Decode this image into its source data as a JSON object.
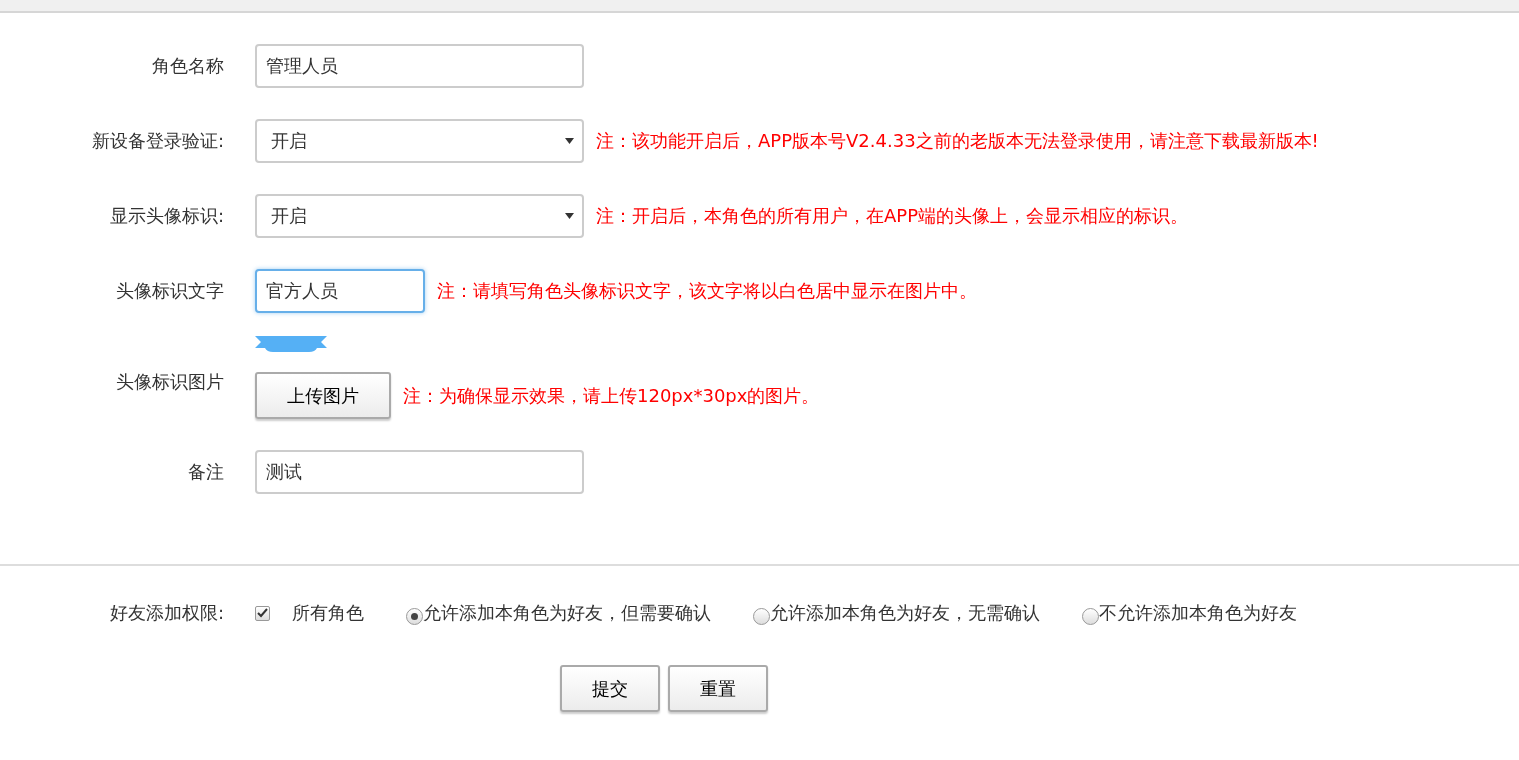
{
  "form": {
    "rows": [
      {
        "kind": "text",
        "label": "角色名称",
        "value": "管理人员"
      },
      {
        "kind": "select",
        "label": "新设备登录验证:",
        "value": "开启",
        "note": "注：该功能开启后，APP版本号V2.4.33之前的老版本无法登录使用，请注意下载最新版本!"
      },
      {
        "kind": "select",
        "label": "显示头像标识:",
        "value": "开启",
        "note": "注：开启后，本角色的所有用户，在APP端的头像上，会显示相应的标识。"
      },
      {
        "kind": "short_text",
        "label": "头像标识文字",
        "value": "官方人员",
        "focused": true,
        "note": "注：请填写角色头像标识文字，该文字将以白色居中显示在图片中。"
      },
      {
        "kind": "image",
        "label": "头像标识图片",
        "button": "上传图片",
        "note": "注：为确保显示效果，请上传120px*30px的图片。"
      },
      {
        "kind": "text",
        "label": "备注",
        "value": "测试"
      }
    ]
  },
  "friend_permission": {
    "label": "好友添加权限:",
    "all_roles": {
      "label": "所有角色",
      "checked": true
    },
    "options": [
      {
        "label": "允许添加本角色为好友，但需要确认",
        "selected": true
      },
      {
        "label": "允许添加本角色为好友，无需确认",
        "selected": false
      },
      {
        "label": "不允许添加本角色为好友",
        "selected": false
      }
    ]
  },
  "buttons": [
    "提交",
    "重置"
  ]
}
